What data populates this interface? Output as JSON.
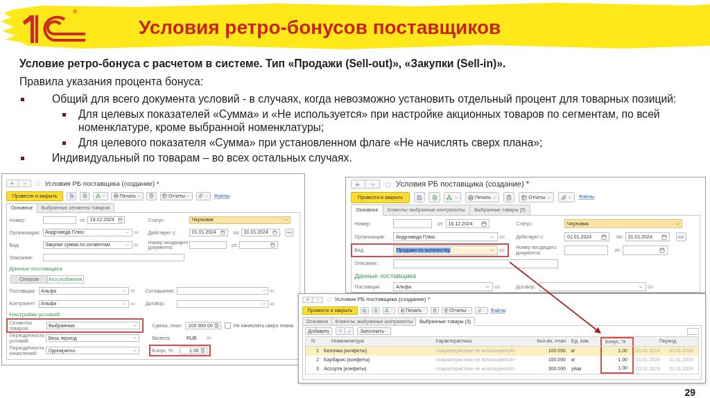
{
  "header": {
    "logo_mark": "®",
    "title": "Условия ретро-бонусов поставщиков"
  },
  "subtitle": "Условие ретро-бонуса с расчетом в системе. Тип «Продажи (Sell-out)», «Закупки (Sell-in)».",
  "intro": "Правила указания процента бонуса:",
  "bullets": [
    {
      "text": "Общий для всего документа условий - в случаях, когда невозможно установить отдельный процент для товарных позиций:",
      "children": [
        {
          "text": "Для целевых показателей «Сумма» и «Не используется» при настройке акционных товаров по сегментам, по всей номенклатуре, кроме выбранной номенклатуры;"
        },
        {
          "text": "Для целевого показателя «Сумма» при установленном флаге «Не начислять сверх плана»;"
        }
      ]
    },
    {
      "text": "Индивидуальный по товарам – во всех остальных случаях."
    }
  ],
  "windows": [
    {
      "kind": "form",
      "title": "Условия РБ поставщика (создание) *",
      "toolbar": {
        "primary": "Провести и закрыть",
        "print": "Печать",
        "reports": "Отчеты",
        "files": "Файлы"
      },
      "tabs": [
        {
          "label": "Основное",
          "selected": true
        },
        {
          "label": "Выбранные сегменты товаров",
          "selected": false
        }
      ],
      "form": {
        "number": {
          "label": "Номер:"
        },
        "date": {
          "label": "от:",
          "value": "16.12.2024"
        },
        "status": {
          "label": "Статус:",
          "value": "Черновик"
        },
        "organization": {
          "label": "Организация:",
          "value": "Андромеда Плюс"
        },
        "valid_from": {
          "label": "Действует с:",
          "value": "01.01.2024"
        },
        "valid_to": {
          "label": "по:",
          "value": "31.01.2024"
        },
        "doc_type": {
          "label": "Вид:",
          "value": "Закупки сумма по сегментам",
          "highlighted": false,
          "text_selected": false
        },
        "incoming_number": {
          "label": "Номер входящего документа:"
        },
        "incoming_date": {
          "label": "от:"
        },
        "description": {
          "label": "Описание:"
        }
      },
      "supplier": {
        "title": "Данные поставщика",
        "modes": [
          {
            "label": "Списком",
            "selected": false
          },
          {
            "label": "Без разбиения",
            "selected": true
          }
        ],
        "rows": [
          [
            {
              "label": "Поставщик:",
              "value": "Альфа"
            },
            {
              "label": "Соглашение:"
            }
          ],
          [
            {
              "label": "Контрагент:",
              "value": "Альфа"
            },
            {
              "label": "Договор:"
            }
          ]
        ]
      },
      "conditions": {
        "title": "Настройки условий",
        "segments": {
          "label": "Сегменты товаров:",
          "value": "Выбранные",
          "highlighted": true
        },
        "plan_sum": {
          "label": "Сумма, план:",
          "value": "200 000.00"
        },
        "over_plan": {
          "label": "Не начислять сверх плана",
          "checked": false
        },
        "conditions_period": {
          "label": "Периодичность условий:",
          "value": "Весь период"
        },
        "currency": {
          "label": "Валюта:",
          "value": "RUB"
        },
        "accrual_period": {
          "label": "Периодичность начислений:",
          "value": "Однократно"
        },
        "bonus": {
          "label": "Бонус, %:",
          "value": "1.00",
          "highlighted": true
        }
      }
    },
    {
      "kind": "form",
      "title": "Условия РБ поставщика (создание) *",
      "toolbar": {
        "primary": "Провести и закрыть",
        "print": "Печать",
        "reports": "Отчеты",
        "files": "Файлы"
      },
      "tabs": [
        {
          "label": "Основное",
          "selected": true
        },
        {
          "label": "Клиенты: выбранные контрагенты",
          "selected": false
        },
        {
          "label": "Выбранные товары (3)",
          "selected": false
        }
      ],
      "form": {
        "number": {
          "label": "Номер:"
        },
        "date": {
          "label": "от:",
          "value": "16.12.2024"
        },
        "status": {
          "label": "Статус:",
          "value": "Черновик"
        },
        "organization": {
          "label": "Организация:",
          "value": "Андромеда Плюс"
        },
        "valid_from": {
          "label": "Действует с:",
          "value": "01.01.2024"
        },
        "valid_to": {
          "label": "по:",
          "value": "31.01.2024"
        },
        "doc_type": {
          "label": "Вид:",
          "value": "Продажи по количеству",
          "highlighted": true,
          "text_selected": true
        },
        "incoming_number": {
          "label": "Номер входящего документа:"
        },
        "incoming_date": {
          "label": "от:"
        },
        "description": {
          "label": "Описание:"
        }
      },
      "supplier": {
        "title": "Данные поставщика",
        "rows": [
          [
            {
              "label": "Поставщик:",
              "value": "Альфа"
            },
            {
              "label": "Договор:"
            }
          ]
        ]
      }
    },
    {
      "kind": "table",
      "title": "Условия РБ поставщика (создание) *",
      "toolbar": {
        "primary": "Провести и закрыть",
        "print": "Печать",
        "reports": "Отчеты",
        "files": "Файлы"
      },
      "tabs": [
        {
          "label": "Основное",
          "selected": false
        },
        {
          "label": "Клиенты: выбранные контрагенты",
          "selected": false
        },
        {
          "label": "Выбранные товары (3)",
          "selected": true
        }
      ],
      "table_toolbar": {
        "add": "Добавить",
        "fill": "Заполнить"
      },
      "columns": [
        {
          "label": "N",
          "highlighted": false
        },
        {
          "label": "Номенклатура",
          "highlighted": false
        },
        {
          "label": "Характеристика",
          "highlighted": false
        },
        {
          "label": "Кол-во, план",
          "highlighted": false
        },
        {
          "label": "Ед. изм.",
          "highlighted": false
        },
        {
          "label": "Бонус, %",
          "highlighted": true
        },
        {
          "label": "Период",
          "highlighted": false
        }
      ],
      "rows": [
        {
          "selected": true,
          "cells": [
            "1",
            "Белочка (конфеты)",
            "<характеристики не используются>",
            "100.000",
            "кг",
            "1.00",
            "01.01.2024",
            "31.01.2024"
          ]
        },
        {
          "selected": false,
          "cells": [
            "2",
            "Барбарис (конфеты)",
            "<характеристики не используются>",
            "100.000",
            "кг",
            "1.00",
            "01.01.2024",
            "31.01.2024"
          ]
        },
        {
          "selected": false,
          "cells": [
            "3",
            "Ассорти (конфеты)",
            "<характеристики не используются>",
            "300.000",
            "упак",
            "1.00",
            "01.01.2024",
            "31.01.2024"
          ]
        }
      ]
    }
  ],
  "page_number": "29"
}
